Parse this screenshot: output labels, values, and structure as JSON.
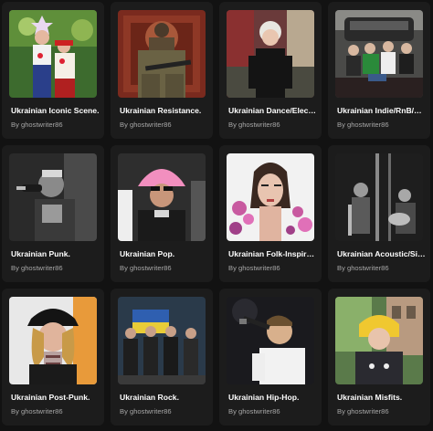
{
  "playlists": [
    {
      "title": "Ukrainian Iconic Scene.",
      "author": "By ghostwriter86",
      "artwork": "portrait-two-women-folk-costume"
    },
    {
      "title": "Ukrainian Resistance.",
      "author": "By ghostwriter86",
      "artwork": "portrait-soldier-with-rifle"
    },
    {
      "title": "Ukrainian Dance/Elec…",
      "author": "By ghostwriter86",
      "artwork": "portrait-woman-black-outfit"
    },
    {
      "title": "Ukrainian Indie/RnB/…",
      "author": "By ghostwriter86",
      "artwork": "portrait-band-with-car"
    },
    {
      "title": "Ukrainian Punk.",
      "author": "By ghostwriter86",
      "artwork": "portrait-singer-microphone-bw"
    },
    {
      "title": "Ukrainian Pop.",
      "author": "By ghostwriter86",
      "artwork": "portrait-man-pink-hat"
    },
    {
      "title": "Ukrainian Folk-Inspir…",
      "author": "By ghostwriter86",
      "artwork": "portrait-woman-flowers"
    },
    {
      "title": "Ukrainian Acoustic/Si…",
      "author": "By ghostwriter86",
      "artwork": "portrait-band-stage-bw"
    },
    {
      "title": "Ukrainian Post-Punk.",
      "author": "By ghostwriter86",
      "artwork": "portrait-person-black-cap"
    },
    {
      "title": "Ukrainian Rock.",
      "author": "By ghostwriter86",
      "artwork": "portrait-band-ukraine-flag"
    },
    {
      "title": "Ukrainian Hip-Hop.",
      "author": "By ghostwriter86",
      "artwork": "portrait-rapper-microphone"
    },
    {
      "title": "Ukrainian Misfits.",
      "author": "By ghostwriter86",
      "artwork": "portrait-person-yellow-hair"
    }
  ],
  "colors": {
    "background": "#121212",
    "card": "#1c1c1c",
    "title": "#ffffff",
    "subtitle": "#a7a7a7"
  }
}
